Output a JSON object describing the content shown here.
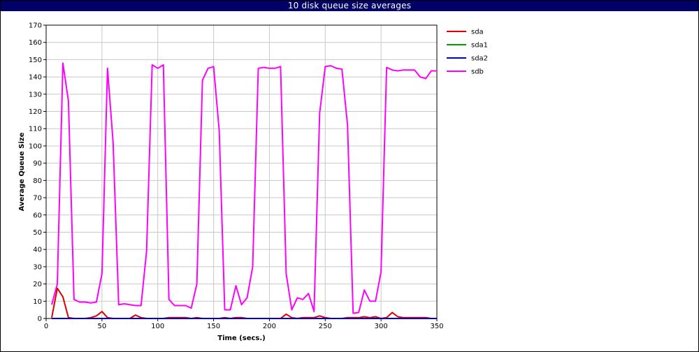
{
  "window": {
    "title": "10 disk queue size averages"
  },
  "chart_data": {
    "type": "line",
    "title": "10 disk queue size averages",
    "xlabel": "Time (secs.)",
    "ylabel": "Average Queue Size",
    "xlim": [
      0,
      350
    ],
    "ylim": [
      0,
      170
    ],
    "x_ticks": [
      0,
      50,
      100,
      150,
      200,
      250,
      300,
      350
    ],
    "y_ticks": [
      0,
      10,
      20,
      30,
      40,
      50,
      60,
      70,
      80,
      90,
      100,
      110,
      120,
      130,
      140,
      150,
      160,
      170
    ],
    "grid": true,
    "legend_position": "right",
    "series": [
      {
        "name": "sdb",
        "color": "#ff00ff",
        "points": [
          [
            5,
            8
          ],
          [
            10,
            20
          ],
          [
            15,
            148
          ],
          [
            20,
            126
          ],
          [
            25,
            11
          ],
          [
            30,
            9.5
          ],
          [
            35,
            9.5
          ],
          [
            40,
            9
          ],
          [
            45,
            9.5
          ],
          [
            50,
            26
          ],
          [
            55,
            145
          ],
          [
            60,
            102
          ],
          [
            65,
            8
          ],
          [
            70,
            8.5
          ],
          [
            75,
            8
          ],
          [
            80,
            7.5
          ],
          [
            85,
            7.5
          ],
          [
            90,
            39
          ],
          [
            95,
            147
          ],
          [
            100,
            145
          ],
          [
            105,
            147
          ],
          [
            110,
            11
          ],
          [
            115,
            7.5
          ],
          [
            120,
            7.5
          ],
          [
            125,
            7.5
          ],
          [
            130,
            6
          ],
          [
            135,
            20
          ],
          [
            140,
            138
          ],
          [
            145,
            145
          ],
          [
            150,
            146
          ],
          [
            155,
            109
          ],
          [
            160,
            5
          ],
          [
            165,
            5
          ],
          [
            170,
            19
          ],
          [
            175,
            8
          ],
          [
            180,
            12
          ],
          [
            185,
            30
          ],
          [
            190,
            145
          ],
          [
            195,
            145.5
          ],
          [
            200,
            145
          ],
          [
            205,
            145
          ],
          [
            210,
            146
          ],
          [
            215,
            26
          ],
          [
            220,
            5
          ],
          [
            225,
            12
          ],
          [
            230,
            11
          ],
          [
            235,
            14.5
          ],
          [
            240,
            4
          ],
          [
            245,
            119
          ],
          [
            250,
            146
          ],
          [
            255,
            146.5
          ],
          [
            260,
            145
          ],
          [
            265,
            144.5
          ],
          [
            270,
            112
          ],
          [
            275,
            3
          ],
          [
            280,
            3.5
          ],
          [
            285,
            16.5
          ],
          [
            290,
            10
          ],
          [
            295,
            10
          ],
          [
            300,
            27
          ],
          [
            305,
            145.5
          ],
          [
            310,
            144
          ],
          [
            315,
            143.5
          ],
          [
            320,
            144
          ],
          [
            325,
            144
          ],
          [
            330,
            144
          ],
          [
            335,
            140
          ],
          [
            340,
            139
          ],
          [
            345,
            143.5
          ],
          [
            350,
            143.5
          ]
        ]
      },
      {
        "name": "sda",
        "color": "#dd0000",
        "points": [
          [
            5,
            0.5
          ],
          [
            10,
            17.5
          ],
          [
            15,
            12.5
          ],
          [
            20,
            0.5
          ],
          [
            25,
            0
          ],
          [
            30,
            0
          ],
          [
            35,
            0
          ],
          [
            40,
            0.5
          ],
          [
            45,
            1.5
          ],
          [
            50,
            4
          ],
          [
            55,
            0.5
          ],
          [
            60,
            0
          ],
          [
            65,
            0
          ],
          [
            70,
            0
          ],
          [
            75,
            0
          ],
          [
            80,
            2
          ],
          [
            85,
            0.5
          ],
          [
            90,
            0
          ],
          [
            95,
            0
          ],
          [
            100,
            0
          ],
          [
            105,
            0
          ],
          [
            110,
            0.5
          ],
          [
            115,
            0.5
          ],
          [
            120,
            0.5
          ],
          [
            125,
            0.5
          ],
          [
            130,
            0
          ],
          [
            135,
            0.5
          ],
          [
            140,
            0
          ],
          [
            145,
            0
          ],
          [
            150,
            0
          ],
          [
            155,
            0
          ],
          [
            160,
            0.5
          ],
          [
            165,
            0
          ],
          [
            170,
            0.5
          ],
          [
            175,
            0.5
          ],
          [
            180,
            0
          ],
          [
            185,
            0
          ],
          [
            190,
            0
          ],
          [
            195,
            0
          ],
          [
            200,
            0
          ],
          [
            205,
            0
          ],
          [
            210,
            0
          ],
          [
            215,
            2.5
          ],
          [
            220,
            0.5
          ],
          [
            225,
            0
          ],
          [
            230,
            0.5
          ],
          [
            235,
            0.5
          ],
          [
            240,
            0.5
          ],
          [
            245,
            1.5
          ],
          [
            250,
            0.5
          ],
          [
            255,
            0
          ],
          [
            260,
            0
          ],
          [
            265,
            0
          ],
          [
            270,
            0.5
          ],
          [
            275,
            0.5
          ],
          [
            280,
            0.5
          ],
          [
            285,
            1
          ],
          [
            290,
            0.5
          ],
          [
            295,
            1
          ],
          [
            300,
            0
          ],
          [
            305,
            0.5
          ],
          [
            310,
            3.5
          ],
          [
            315,
            1
          ],
          [
            320,
            0.5
          ],
          [
            325,
            0.5
          ],
          [
            330,
            0.5
          ],
          [
            335,
            0.5
          ],
          [
            340,
            0.5
          ],
          [
            345,
            0
          ],
          [
            350,
            0
          ]
        ]
      },
      {
        "name": "sda1",
        "color": "#00a000",
        "points": [
          [
            5,
            0
          ],
          [
            350,
            0
          ]
        ]
      },
      {
        "name": "sda2",
        "color": "#0000cc",
        "points": [
          [
            5,
            0
          ],
          [
            350,
            0
          ]
        ]
      }
    ],
    "legend": [
      {
        "name": "sda",
        "color": "#dd0000"
      },
      {
        "name": "sda1",
        "color": "#00a000"
      },
      {
        "name": "sda2",
        "color": "#0000cc"
      },
      {
        "name": "sdb",
        "color": "#ff00ff"
      }
    ]
  }
}
